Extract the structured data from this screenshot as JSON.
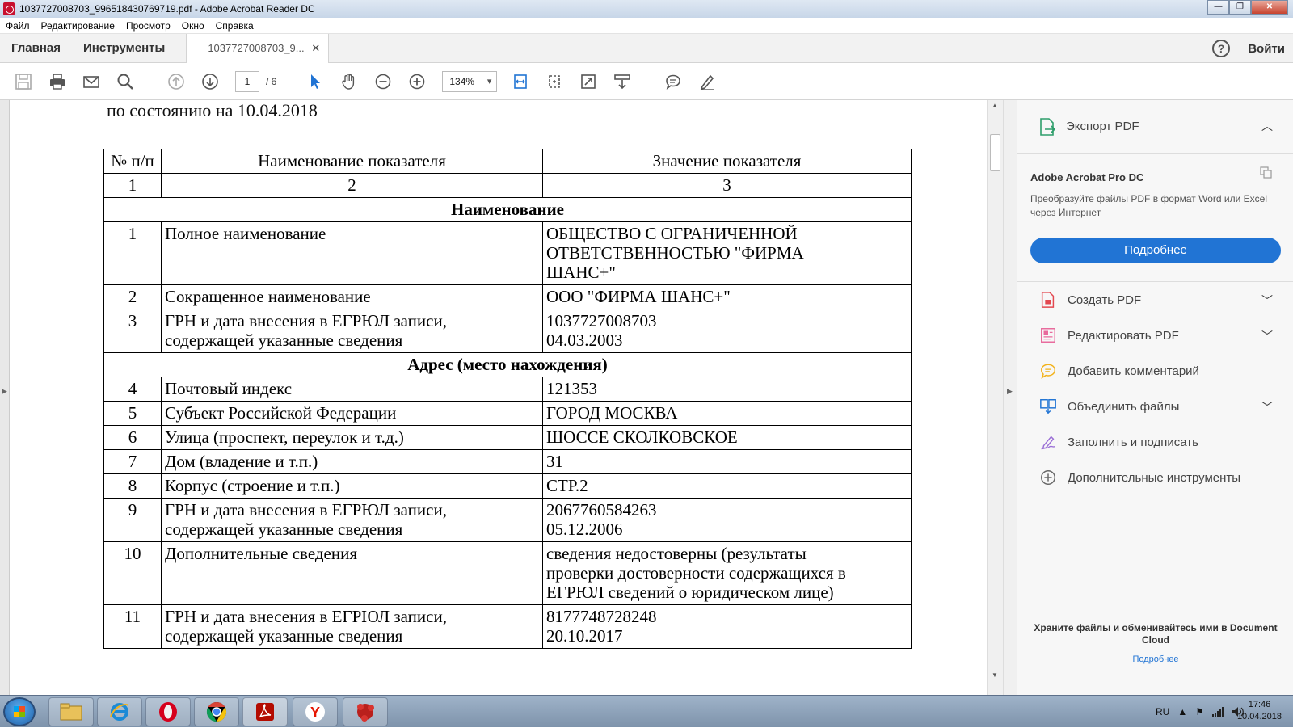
{
  "window": {
    "title": "1037727008703_996518430769719.pdf - Adobe Acrobat Reader DC",
    "controls": {
      "minimize": "—",
      "maximize": "❐",
      "close": "✕"
    }
  },
  "menu": [
    "Файл",
    "Редактирование",
    "Просмотр",
    "Окно",
    "Справка"
  ],
  "tabs": {
    "home": "Главная",
    "tools": "Инструменты",
    "document": "1037727008703_9...",
    "close": "✕",
    "help": "?",
    "signin": "Войти"
  },
  "toolbar": {
    "current_page": "1",
    "total_pages": "/ 6",
    "zoom": "134%"
  },
  "document": {
    "subtitle": "по состоянию на 10.04.2018",
    "header": {
      "num": "№ п/п",
      "name": "Наименование показателя",
      "value": "Значение показателя"
    },
    "index_row": {
      "num": "1",
      "name": "2",
      "value": "3"
    },
    "section_name": "Наименование",
    "section_address": "Адрес (место нахождения)",
    "rows": [
      {
        "num": "1",
        "name": "Полное наименование",
        "value": "ОБЩЕСТВО С ОГРАНИЧЕННОЙ\nОТВЕТСТВЕННОСТЬЮ \"ФИРМА\nШАНС+\""
      },
      {
        "num": "2",
        "name": "Сокращенное наименование",
        "value": "ООО \"ФИРМА ШАНС+\""
      },
      {
        "num": "3",
        "name": "ГРН и дата внесения в ЕГРЮЛ записи,\nсодержащей указанные сведения",
        "value": "1037727008703\n04.03.2003"
      },
      {
        "num": "4",
        "name": "Почтовый индекс",
        "value": "121353"
      },
      {
        "num": "5",
        "name": "Субъект Российской Федерации",
        "value": "ГОРОД МОСКВА"
      },
      {
        "num": "6",
        "name": "Улица (проспект, переулок и т.д.)",
        "value": "ШОССЕ СКОЛКОВСКОЕ"
      },
      {
        "num": "7",
        "name": "Дом (владение и т.п.)",
        "value": "31"
      },
      {
        "num": "8",
        "name": "Корпус (строение и т.п.)",
        "value": "СТР.2"
      },
      {
        "num": "9",
        "name": "ГРН и дата внесения в ЕГРЮЛ записи,\nсодержащей указанные сведения",
        "value": "2067760584263\n05.12.2006"
      },
      {
        "num": "10",
        "name": "Дополнительные сведения",
        "value": "сведения недостоверны (результаты\nпроверки достоверности содержащихся в\nЕГРЮЛ сведений о юридическом лице)"
      },
      {
        "num": "11",
        "name": "ГРН и дата внесения в ЕГРЮЛ записи,\nсодержащей указанные сведения",
        "value": "8177748728248\n20.10.2017"
      }
    ]
  },
  "right_panel": {
    "export_label": "Экспорт PDF",
    "promo_title": "Adobe Acrobat Pro DC",
    "promo_text": "Преобразуйте файлы PDF в формат Word или Excel через Интернет",
    "promo_button": "Подробнее",
    "items": [
      {
        "label": "Создать PDF",
        "icon": "create-pdf-icon",
        "color": "#e34850"
      },
      {
        "label": "Редактировать PDF",
        "icon": "edit-pdf-icon",
        "color": "#e86a9c"
      },
      {
        "label": "Добавить комментарий",
        "icon": "comment-icon",
        "color": "#f2b21b"
      },
      {
        "label": "Объединить файлы",
        "icon": "combine-files-icon",
        "color": "#2174d4"
      },
      {
        "label": "Заполнить и подписать",
        "icon": "fill-sign-icon",
        "color": "#9b6fd6"
      },
      {
        "label": "Дополнительные инструменты",
        "icon": "more-tools-icon",
        "color": "#666666"
      }
    ],
    "footer_text": "Храните файлы и обменивайтесь ими в Document Cloud",
    "footer_link": "Подробнее"
  },
  "taskbar": {
    "language": "RU",
    "time": "17:46",
    "date": "10.04.2018"
  },
  "colors": {
    "accent": "#2174d4",
    "acrobat_red": "#c8102e"
  }
}
